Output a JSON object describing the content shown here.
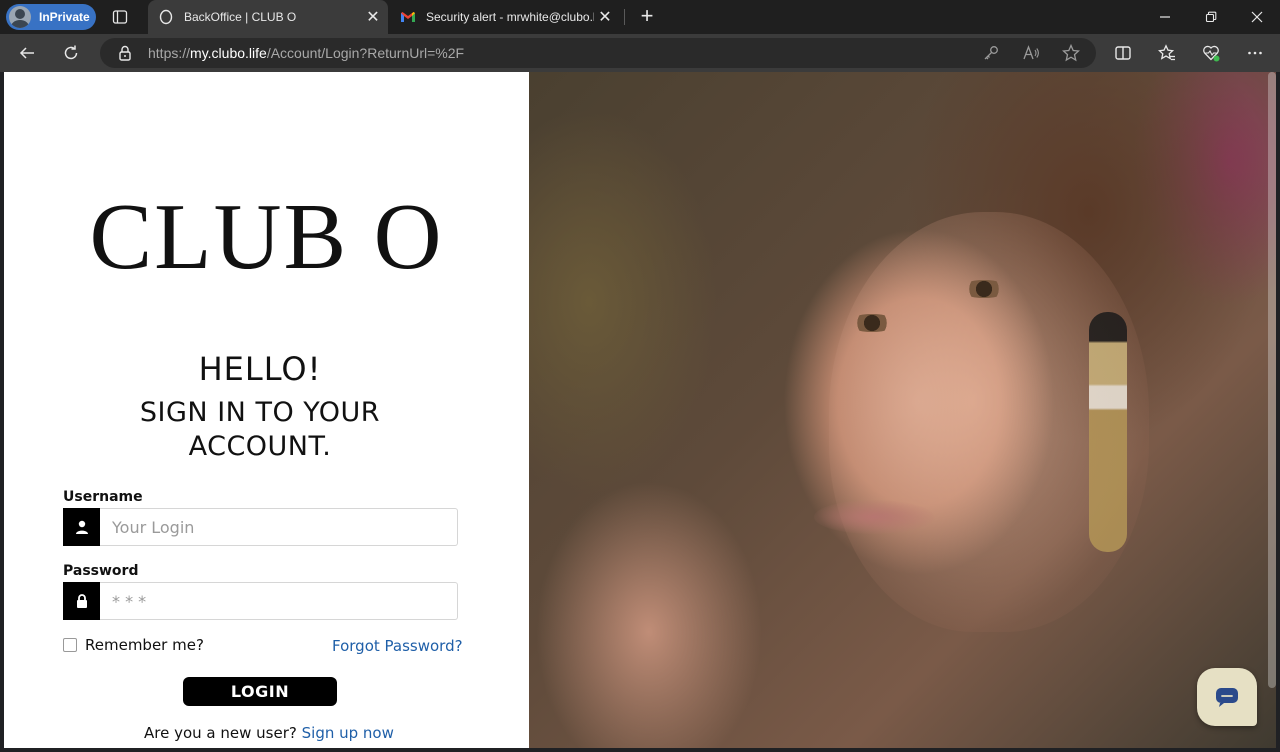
{
  "browser": {
    "inprivate_label": "InPrivate",
    "tabs": [
      {
        "title": "BackOffice | CLUB O",
        "active": true
      },
      {
        "title": "Security alert - mrwhite@clubo.life",
        "active": false
      }
    ],
    "url": {
      "scheme": "https://",
      "host": "my.clubo.life",
      "path": "/Account/Login?ReturnUrl=%2F"
    }
  },
  "login": {
    "logo": "CLUB O",
    "greeting": "HELLO!",
    "subtitle": "SIGN IN TO YOUR ACCOUNT.",
    "username_label": "Username",
    "username_placeholder": "Your Login",
    "password_label": "Password",
    "password_placeholder": "* * *",
    "remember_label": "Remember me?",
    "forgot_label": "Forgot Password?",
    "login_button": "LOGIN",
    "new_user_text": "Are you a new user?",
    "signup_link": "Sign up now"
  },
  "colors": {
    "accent_link": "#1f5fa8",
    "button_bg": "#000000",
    "inprivate_pill": "#3872c4",
    "chat_bubble": "#e6e0c4"
  }
}
